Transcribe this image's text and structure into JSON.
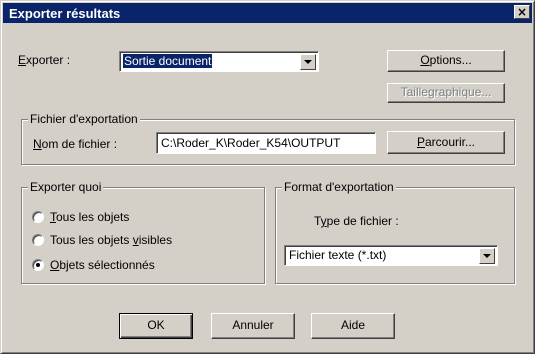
{
  "window": {
    "title": "Exporter résultats",
    "close_glyph": "×"
  },
  "export": {
    "label_ul": "E",
    "label_rest": "xporter :",
    "selected": "Sortie document"
  },
  "buttons": {
    "options_ul": "O",
    "options_rest": "ptions...",
    "graph_size_a": "Taille ",
    "graph_size_ul": "g",
    "graph_size_b": "raphique...",
    "browse_ul": "P",
    "browse_rest": "arcourir...",
    "ok": "OK",
    "cancel": "Annuler",
    "help": "Aide"
  },
  "file_group": {
    "title": "Fichier d'exportation",
    "filename_label_ul": "N",
    "filename_label_rest": "om de fichier :",
    "filename_value": "C:\\Roder_K\\Roder_K54\\OUTPUT"
  },
  "what_group": {
    "title": "Exporter quoi",
    "options": [
      {
        "ul": "T",
        "rest": "ous les objets",
        "checked": false
      },
      {
        "pre": "Tous les objets ",
        "ul": "v",
        "rest": "isibles",
        "checked": false
      },
      {
        "ul": "O",
        "rest": "bjets sélectionnés",
        "checked": true
      }
    ]
  },
  "format_group": {
    "title": "Format d'exportation",
    "type_label_a": "T",
    "type_label_ul": "y",
    "type_label_b": "pe de fichier :",
    "selected": "Fichier texte (*.txt)"
  },
  "colors": {
    "titlebar": "#0a246a",
    "face": "#d4d0c8",
    "selection": "#0a246a"
  }
}
